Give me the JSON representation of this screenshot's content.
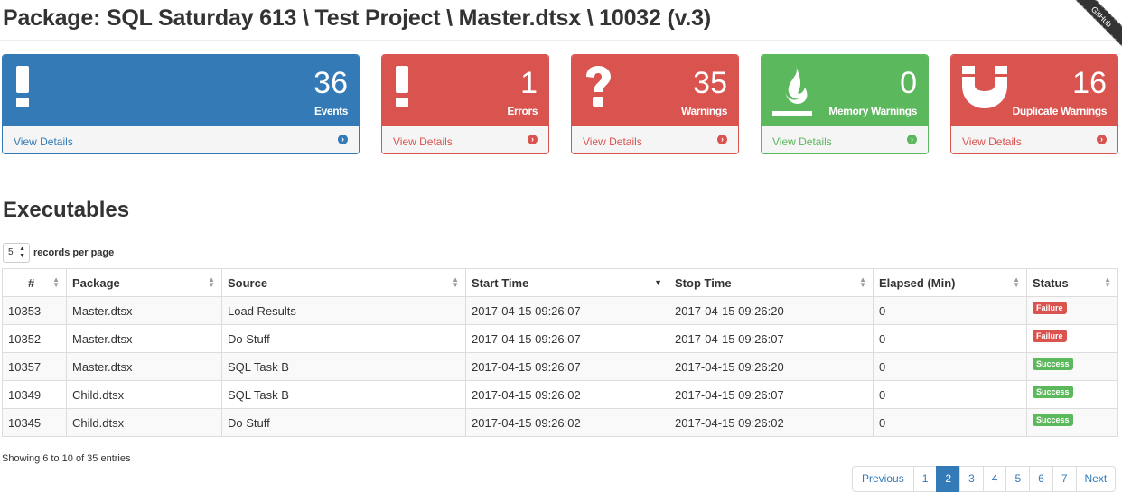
{
  "header": {
    "title": "Package: SQL Saturday 613 \\ Test Project \\ Master.dtsx \\ 10032 (v.3)",
    "ribbon": "GitHub"
  },
  "panels": [
    {
      "count": "36",
      "label": "Events",
      "link": "View Details",
      "icon": "exclamation-icon",
      "color": "#337ab7"
    },
    {
      "count": "1",
      "label": "Errors",
      "link": "View Details",
      "icon": "exclamation-icon",
      "color": "#d9534f"
    },
    {
      "count": "35",
      "label": "Warnings",
      "link": "View Details",
      "icon": "question-icon",
      "color": "#d9534f"
    },
    {
      "count": "0",
      "label": "Memory Warnings",
      "link": "View Details",
      "icon": "fire-icon",
      "color": "#5cb85c"
    },
    {
      "count": "16",
      "label": "Duplicate Warnings",
      "link": "View Details",
      "icon": "magnet-icon",
      "color": "#d9534f"
    }
  ],
  "executables": {
    "title": "Executables",
    "page_size": "5",
    "page_size_label": "records per page",
    "columns": [
      "#",
      "Package",
      "Source",
      "Start Time",
      "Stop Time",
      "Elapsed (Min)",
      "Status"
    ],
    "rows": [
      {
        "id": "10353",
        "package": "Master.dtsx",
        "source": "Load Results",
        "start": "2017-04-15 09:26:07",
        "stop": "2017-04-15 09:26:20",
        "elapsed": "0",
        "status": "Failure"
      },
      {
        "id": "10352",
        "package": "Master.dtsx",
        "source": "Do Stuff",
        "start": "2017-04-15 09:26:07",
        "stop": "2017-04-15 09:26:07",
        "elapsed": "0",
        "status": "Failure"
      },
      {
        "id": "10357",
        "package": "Master.dtsx",
        "source": "SQL Task B",
        "start": "2017-04-15 09:26:07",
        "stop": "2017-04-15 09:26:20",
        "elapsed": "0",
        "status": "Success"
      },
      {
        "id": "10349",
        "package": "Child.dtsx",
        "source": "SQL Task B",
        "start": "2017-04-15 09:26:02",
        "stop": "2017-04-15 09:26:07",
        "elapsed": "0",
        "status": "Success"
      },
      {
        "id": "10345",
        "package": "Child.dtsx",
        "source": "Do Stuff",
        "start": "2017-04-15 09:26:02",
        "stop": "2017-04-15 09:26:02",
        "elapsed": "0",
        "status": "Success"
      }
    ],
    "info": "Showing 6 to 10 of 35 entries",
    "pagination": {
      "previous": "Previous",
      "next": "Next",
      "pages": [
        "1",
        "2",
        "3",
        "4",
        "5",
        "6",
        "7"
      ],
      "current": "2"
    }
  }
}
